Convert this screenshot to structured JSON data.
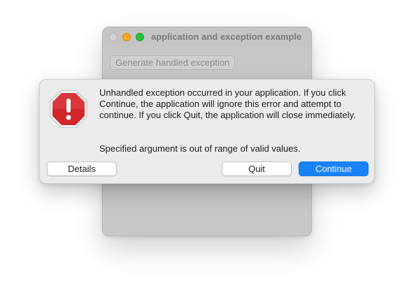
{
  "window": {
    "title": "application and exception example",
    "generate_button_label": "Generate handled exception"
  },
  "alert": {
    "icon": "stop-exclamation-icon",
    "message": "Unhandled exception occurred in your application. If you click Continue, the application will ignore this error and attempt to continue. If you click Quit, the application will close immediately.",
    "detail": "Specified argument is out of range of valid values.",
    "buttons": {
      "details": "Details",
      "quit": "Quit",
      "continue": "Continue"
    }
  },
  "colors": {
    "accent": "#1a82f7",
    "stop_icon": "#d0262a",
    "traffic_minimize": "#f5a623",
    "traffic_zoom": "#2bbf40"
  }
}
